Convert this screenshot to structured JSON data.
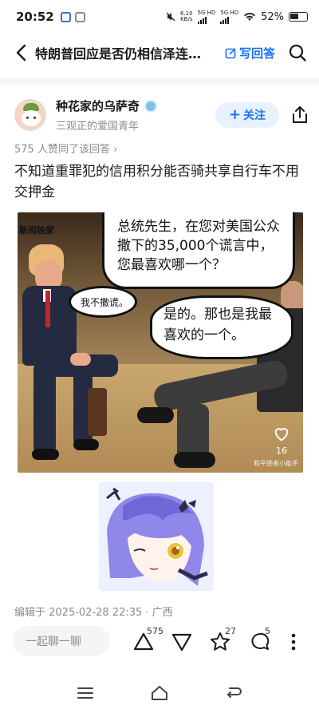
{
  "status_bar": {
    "time": "20:52",
    "net_speed_value": "6.10",
    "net_speed_unit": "KB/s",
    "sig1_label": "5G HD",
    "sig2_label": "5G HD",
    "battery": "52%"
  },
  "nav": {
    "title": "特朗普回应是否仍相信泽连…",
    "write_answer": "写回答"
  },
  "author": {
    "name": "种花家的乌萨奇",
    "bio": "三观正的爱国青年",
    "follow_label": "关注"
  },
  "answer": {
    "agree_text": "575 人赞同了该回答 ›",
    "text": "不知道重罪犯的信用积分能否骑共享自行车不用交押金",
    "image_overlay_label": "新闻独家",
    "bubble_question": "总统先生，在您对美国公众撒下的35,000个谎言中，您最喜欢哪一个？",
    "bubble_trump": "我不撒谎。",
    "bubble_reply": "是的。那也是我最喜欢的一个。",
    "image_like_count": "16",
    "watermark": "和平使者小能手",
    "edited_text": "编辑于 2025-02-28 22:35 · 广西"
  },
  "action_bar": {
    "chat_placeholder": "一起聊一聊",
    "upvote_count": "575",
    "star_count": "27",
    "comment_count": "5"
  },
  "colors": {
    "accent": "#1772f6",
    "follow_bg": "#e8f1ff"
  }
}
